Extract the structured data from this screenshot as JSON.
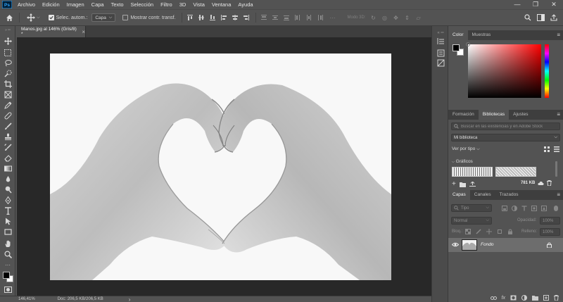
{
  "menubar": {
    "logo": "Ps",
    "items": [
      "Archivo",
      "Edición",
      "Imagen",
      "Capa",
      "Texto",
      "Selección",
      "Filtro",
      "3D",
      "Vista",
      "Ventana",
      "Ayuda"
    ],
    "window_controls": [
      "—",
      "❐",
      "✕"
    ]
  },
  "options": {
    "auto_select_label": "Selec. autom.:",
    "auto_select_value": "Capa",
    "show_transform_label": "Mostrar contr. transf.",
    "mode_3d": "Modo 3D:"
  },
  "document_tab": {
    "title": "Manos.jpg al 146% (Gris/8) *",
    "close": "×"
  },
  "status": {
    "zoom": "146,41%",
    "doc": "Doc: 206,5 KB/206,5 KB",
    "arrow": "›"
  },
  "color_panel": {
    "tabs": [
      "Color",
      "Muestras"
    ],
    "active": 0
  },
  "libraries_panel": {
    "tabs": [
      "Formación",
      "Bibliotecas",
      "Ajustes"
    ],
    "active": 1,
    "search_placeholder": "Buscar en las existencias y en Adobe Stock",
    "library_name": "Mi biblioteca",
    "view_label": "Ver por tipo",
    "graphics_label": "Gráficos",
    "size": "781 KB"
  },
  "layers_panel": {
    "tabs": [
      "Capas",
      "Canales",
      "Trazados"
    ],
    "active": 0,
    "kind_placeholder": "Tipo",
    "blend_mode": "Normal",
    "opacity_label": "Opacidad:",
    "opacity_value": "100%",
    "lock_label": "Bloq.:",
    "fill_label": "Relleno:",
    "fill_value": "100%",
    "layers": [
      {
        "name": "Fondo",
        "visible": true,
        "locked": true
      }
    ]
  },
  "colors": {
    "ui_dark": "#535353",
    "panel_tab": "#3e3e3e",
    "canvas_bg": "#282828",
    "foreground": "#000000",
    "background": "#ffffff",
    "picker_hue": "#ff0000"
  }
}
